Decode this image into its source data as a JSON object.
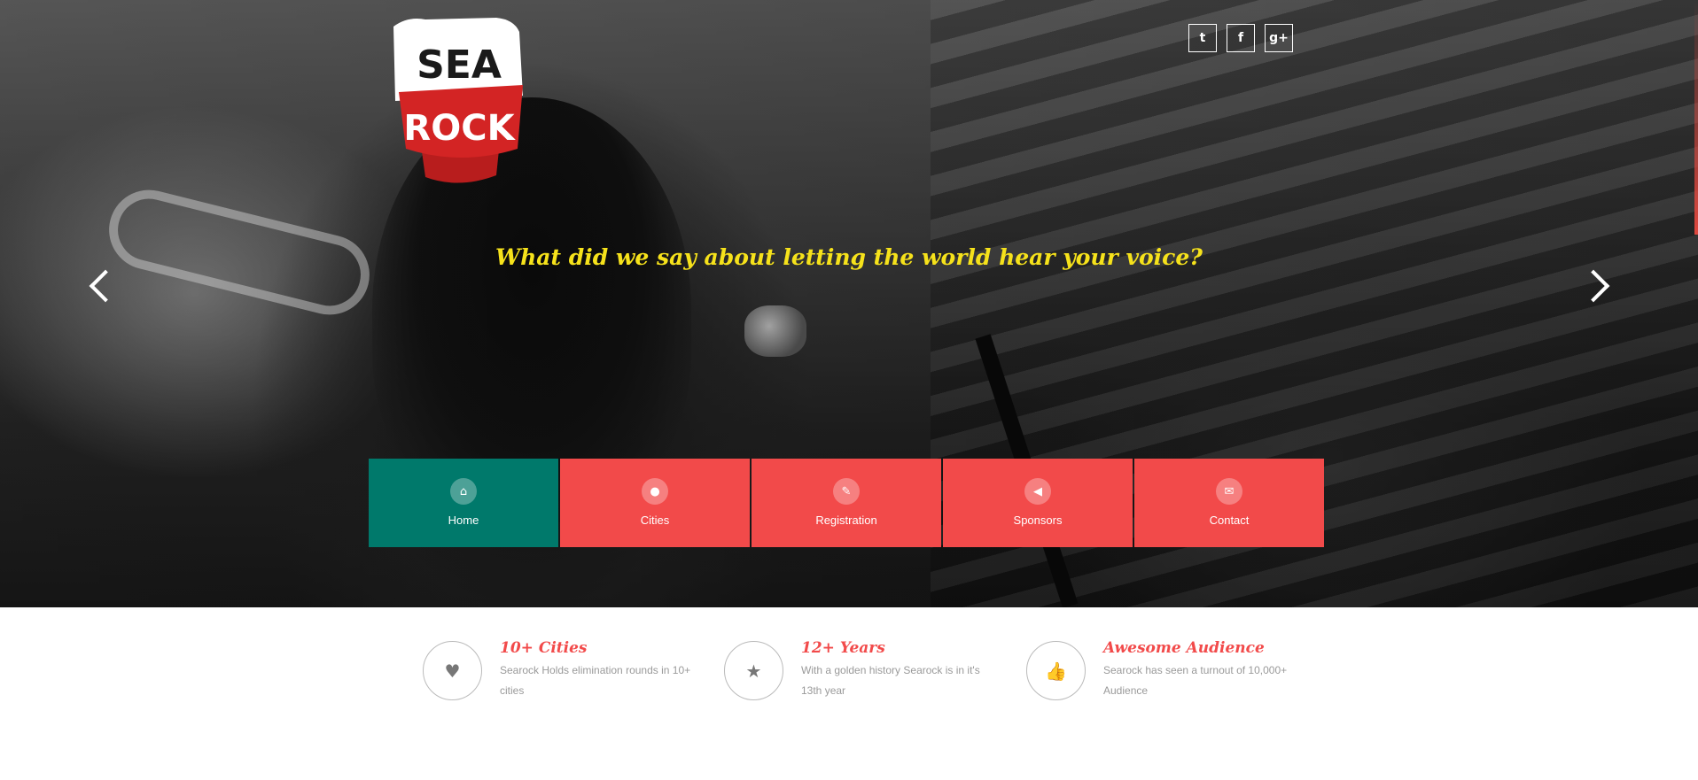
{
  "brand": {
    "logo_line1": "SEA",
    "logo_line2": "ROCK",
    "logo_colors": {
      "white": "#ffffff",
      "red": "#d32424"
    }
  },
  "social": [
    {
      "name": "twitter",
      "glyph": "t"
    },
    {
      "name": "facebook",
      "glyph": "f"
    },
    {
      "name": "google-plus",
      "glyph": "g+"
    }
  ],
  "hero": {
    "tagline": "What did we say about letting the world hear your voice?",
    "tagline_color": "#f6e21b"
  },
  "nav": [
    {
      "label": "Home",
      "icon": "home-icon",
      "glyph": "⌂",
      "active": true
    },
    {
      "label": "Cities",
      "icon": "map-pin-icon",
      "glyph": "●",
      "active": false
    },
    {
      "label": "Registration",
      "icon": "edit-icon",
      "glyph": "✎",
      "active": false
    },
    {
      "label": "Sponsors",
      "icon": "megaphone-icon",
      "glyph": "◀",
      "active": false
    },
    {
      "label": "Contact",
      "icon": "envelope-icon",
      "glyph": "✉",
      "active": false
    }
  ],
  "colors": {
    "accent_red": "#f24a4a",
    "active_teal": "#00796b"
  },
  "features": [
    {
      "title": "10+ Cities",
      "desc": "Searock Holds elimination rounds in 10+ cities",
      "icon": "heart-icon",
      "glyph": "♥"
    },
    {
      "title": "12+ Years",
      "desc": "With a golden history Searock is in it's 13th year",
      "icon": "star-half-icon",
      "glyph": "★"
    },
    {
      "title": "Awesome Audience",
      "desc": "Searock has seen a turnout of 10,000+ Audience",
      "icon": "thumbs-up-icon",
      "glyph": "👍"
    }
  ]
}
